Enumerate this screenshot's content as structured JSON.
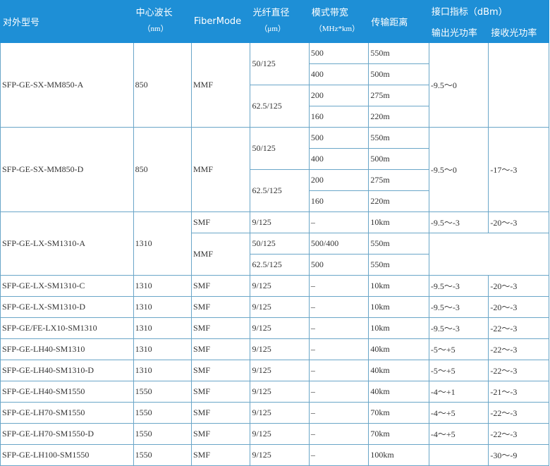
{
  "headers": {
    "model": "对外型号",
    "wavelength": "中心波长",
    "wavelength_unit": "（nm）",
    "fiber_mode": "FiberMode",
    "diameter": "光纤直径",
    "diameter_unit": "（μm）",
    "bandwidth": "模式带宽",
    "bandwidth_unit": "（MHz*km）",
    "distance": "传输距离",
    "interface": "接口指标（dBm）",
    "output_power": "输出光功率",
    "input_power": "接收光功率"
  },
  "groups": {
    "g1": {
      "model": "SFP-GE-SX-MM850-A",
      "wavelength": "850",
      "fiber": "MMF",
      "dia_a": "50/125",
      "dia_b": "62.5/125",
      "rows": [
        {
          "bw": "500",
          "dist": "550m"
        },
        {
          "bw": "400",
          "dist": "500m"
        },
        {
          "bw": "200",
          "dist": "275m"
        },
        {
          "bw": "160",
          "dist": "220m"
        }
      ],
      "out": "-9.5～0",
      "in": ""
    },
    "g2": {
      "model": "SFP-GE-SX-MM850-D",
      "wavelength": "850",
      "fiber": "MMF",
      "dia_a": "50/125",
      "dia_b": "62.5/125",
      "rows": [
        {
          "bw": "500",
          "dist": "550m"
        },
        {
          "bw": "400",
          "dist": "500m"
        },
        {
          "bw": "200",
          "dist": "275m"
        },
        {
          "bw": "160",
          "dist": "220m"
        }
      ],
      "out": "-9.5～0",
      "in": "-17～-3"
    },
    "g3": {
      "model": "SFP-GE-LX-SM1310-A",
      "wavelength": "1310",
      "fiber_smf": "SMF",
      "fiber_mmf": "MMF",
      "rows": [
        {
          "dia": "9/125",
          "bw": "–",
          "dist": "10km"
        },
        {
          "dia": "50/125",
          "bw": "500/400",
          "dist": "550m"
        },
        {
          "dia": "62.5/125",
          "bw": "500",
          "dist": "550m"
        }
      ],
      "out": "-9.5～-3",
      "in": "-20～-3"
    }
  },
  "simple_rows": [
    {
      "model": "SFP-GE-LX-SM1310-C",
      "wavelength": "1310",
      "fiber": "SMF",
      "dia": "9/125",
      "bw": "–",
      "dist": "10km",
      "out": "-9.5～-3",
      "in": "-20～-3"
    },
    {
      "model": "SFP-GE-LX-SM1310-D",
      "wavelength": "1310",
      "fiber": "SMF",
      "dia": "9/125",
      "bw": "–",
      "dist": "10km",
      "out": "-9.5～-3",
      "in": "-20～-3"
    },
    {
      "model": "SFP-GE/FE-LX10-SM1310",
      "wavelength": "1310",
      "fiber": "SMF",
      "dia": "9/125",
      "bw": "–",
      "dist": "10km",
      "out": "-9.5～-3",
      "in": "-22～-3"
    },
    {
      "model": "SFP-GE-LH40-SM1310",
      "wavelength": "1310",
      "fiber": "SMF",
      "dia": "9/125",
      "bw": "–",
      "dist": "40km",
      "out": "-5～+5",
      "in": "-22～-3"
    },
    {
      "model": "SFP-GE-LH40-SM1310-D",
      "wavelength": "1310",
      "fiber": "SMF",
      "dia": "9/125",
      "bw": "–",
      "dist": "40km",
      "out": "-5～+5",
      "in": "-22～-3"
    },
    {
      "model": "SFP-GE-LH40-SM1550",
      "wavelength": "1550",
      "fiber": "SMF",
      "dia": "9/125",
      "bw": "–",
      "dist": "40km",
      "out": "-4～+1",
      "in": "-21～-3"
    },
    {
      "model": "SFP-GE-LH70-SM1550",
      "wavelength": "1550",
      "fiber": "SMF",
      "dia": "9/125",
      "bw": "–",
      "dist": "70km",
      "out": "-4～+5",
      "in": "-22～-3"
    },
    {
      "model": "SFP-GE-LH70-SM1550-D",
      "wavelength": "1550",
      "fiber": "SMF",
      "dia": "9/125",
      "bw": "–",
      "dist": "70km",
      "out": "-4～+5",
      "in": "-22～-3"
    },
    {
      "model": "SFP-GE-LH100-SM1550",
      "wavelength": "1550",
      "fiber": "SMF",
      "dia": "9/125",
      "bw": "–",
      "dist": "100km",
      "out": "",
      "in": "-30～-9"
    }
  ]
}
